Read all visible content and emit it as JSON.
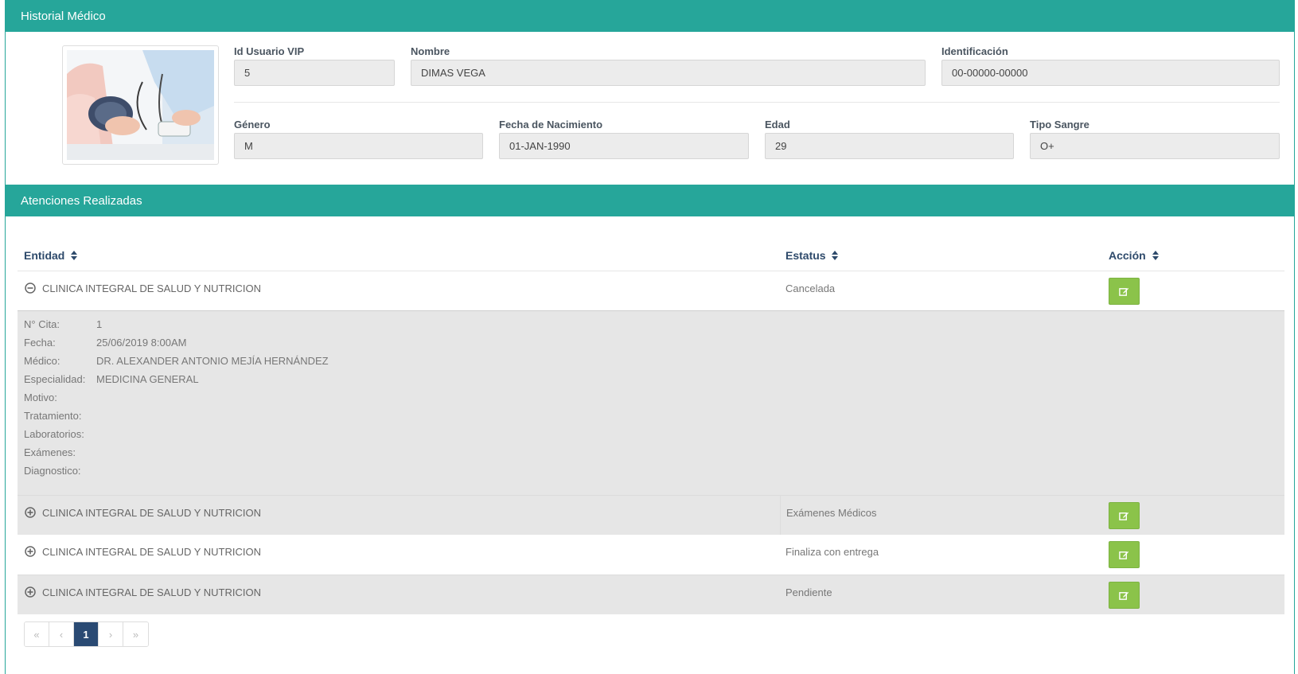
{
  "header": {
    "title": "Historial Médico"
  },
  "patient": {
    "photo_icon": "doctor-blood-pressure-photo",
    "fields": {
      "id_usuario_vip": {
        "label": "Id Usuario VIP",
        "value": "5"
      },
      "nombre": {
        "label": "Nombre",
        "value": "DIMAS VEGA"
      },
      "identificacion": {
        "label": "Identificación",
        "value": "00-00000-00000"
      },
      "genero": {
        "label": "Género",
        "value": "M"
      },
      "fecha_nacimiento": {
        "label": "Fecha de Nacimiento",
        "value": "01-JAN-1990"
      },
      "edad": {
        "label": "Edad",
        "value": "29"
      },
      "tipo_sangre": {
        "label": "Tipo Sangre",
        "value": "O+"
      }
    }
  },
  "atenciones": {
    "title": "Atenciones Realizadas",
    "columns": [
      "Entidad",
      "Estatus",
      "Acción"
    ],
    "rows": [
      {
        "entidad": "CLINICA INTEGRAL DE SALUD Y NUTRICION",
        "estatus": "Cancelada",
        "expanded": true,
        "toggle_icon": "minus-circle-icon",
        "action_icon": "edit-icon"
      },
      {
        "entidad": "CLINICA INTEGRAL DE SALUD Y NUTRICION",
        "estatus": "Exámenes Médicos",
        "expanded": false,
        "toggle_icon": "plus-circle-icon",
        "action_icon": "edit-icon"
      },
      {
        "entidad": "CLINICA INTEGRAL DE SALUD Y NUTRICION",
        "estatus": "Finaliza con entrega",
        "expanded": false,
        "toggle_icon": "plus-circle-icon",
        "action_icon": "edit-icon"
      },
      {
        "entidad": "CLINICA INTEGRAL DE SALUD Y NUTRICION",
        "estatus": "Pendiente",
        "expanded": false,
        "toggle_icon": "plus-circle-icon",
        "action_icon": "edit-icon"
      }
    ],
    "detail": [
      {
        "label": "N° Cita:",
        "value": "1"
      },
      {
        "label": "Fecha:",
        "value": "25/06/2019 8:00AM"
      },
      {
        "label": "Médico:",
        "value": "DR. ALEXANDER ANTONIO MEJÍA HERNÁNDEZ"
      },
      {
        "label": "Especialidad:",
        "value": "MEDICINA GENERAL"
      },
      {
        "label": "Motivo:",
        "value": ""
      },
      {
        "label": "Tratamiento:",
        "value": ""
      },
      {
        "label": "Laboratorios:",
        "value": ""
      },
      {
        "label": "Exámenes:",
        "value": ""
      },
      {
        "label": "Diagnostico:",
        "value": ""
      }
    ]
  },
  "pagination": {
    "first": "«",
    "prev": "‹",
    "current": "1",
    "next": "›",
    "last": "»"
  },
  "colors": {
    "header_bg": "#26a69a",
    "edit_button": "#8bc34a",
    "active_page": "#2a4a73",
    "column_header_text": "#2e4a6b"
  }
}
